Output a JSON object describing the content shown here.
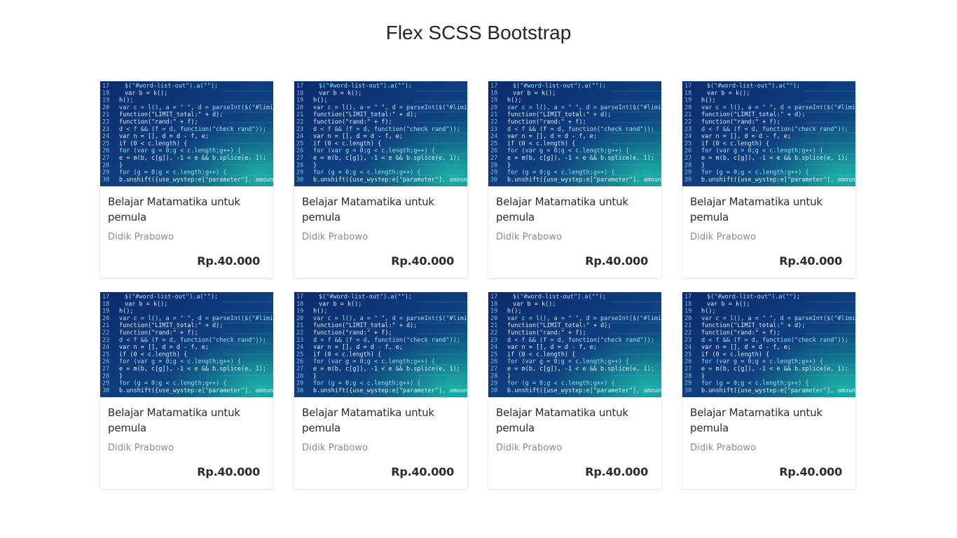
{
  "page": {
    "title": "Flex SCSS Bootstrap"
  },
  "cards": [
    {
      "title": "Belajar Matamatika untuk pemula",
      "author": "Didik Prabowo",
      "price": "Rp.40.000"
    },
    {
      "title": "Belajar Matamatika untuk pemula",
      "author": "Didik Prabowo",
      "price": "Rp.40.000"
    },
    {
      "title": "Belajar Matamatika untuk pemula",
      "author": "Didik Prabowo",
      "price": "Rp.40.000"
    },
    {
      "title": "Belajar Matamatika untuk pemula",
      "author": "Didik Prabowo",
      "price": "Rp.40.000"
    },
    {
      "title": "Belajar Matamatika untuk pemula",
      "author": "Didik Prabowo",
      "price": "Rp.40.000"
    },
    {
      "title": "Belajar Matamatika untuk pemula",
      "author": "Didik Prabowo",
      "price": "Rp.40.000"
    },
    {
      "title": "Belajar Matamatika untuk pemula",
      "author": "Didik Prabowo",
      "price": "Rp.40.000"
    },
    {
      "title": "Belajar Matamatika untuk pemula",
      "author": "Didik Prabowo",
      "price": "Rp.40.000"
    }
  ],
  "thumbnail": {
    "code_lines": [
      {
        "n": "17",
        "code": "$(\"#word-list-out\").a(\"\");"
      },
      {
        "n": "18",
        "code": "var b = k();"
      },
      {
        "n": "19",
        "code": "h();"
      },
      {
        "n": "20",
        "code": "var c = l(), a = \" \", d = parseInt($(\"#limit_val\").a());"
      },
      {
        "n": "21",
        "code": "function(\"LIMIT_total:\" + d);"
      },
      {
        "n": "22",
        "code": "function(\"rand:\" + f);"
      },
      {
        "n": "23",
        "code": "d < f && (f = d, function(\"check rand\"));"
      },
      {
        "n": "24",
        "code": "var n = [], d = d - f, e;"
      },
      {
        "n": "25",
        "code": "if (0 < c.length) {"
      },
      {
        "n": "26",
        "code": "  for (var g = 0;g < c.length;g++) {"
      },
      {
        "n": "27",
        "code": "    e = m(b, c[g]), -1 < e && b.splice(e, 1);"
      },
      {
        "n": "28",
        "code": "  }"
      },
      {
        "n": "29",
        "code": "  for (g = 0;g < c.length;g++) {"
      },
      {
        "n": "30",
        "code": "    b.unshift({use_wystep:e[\"parameter\"], amount});"
      }
    ],
    "colors": {
      "bg_top": "#0b2a6b",
      "bg_mid": "#0f3f7f",
      "bg_glow": "#1fb3a8",
      "line_num": "#6fc0e8",
      "code": "#d6f2ff",
      "keyword": "#8fe3ff"
    }
  },
  "colors": {
    "title": "#212529",
    "card_title": "#2b2b2b",
    "author": "#8a8a8a",
    "price": "#2b2b2b"
  }
}
